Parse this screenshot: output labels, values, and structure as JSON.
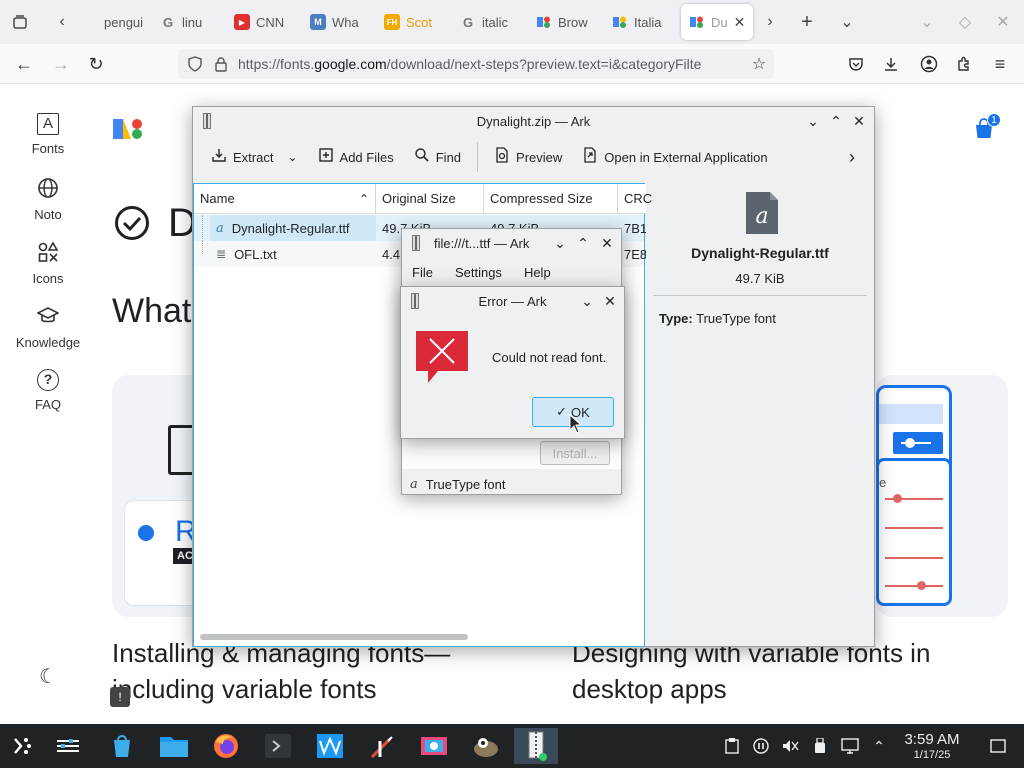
{
  "browser": {
    "tabs": [
      {
        "label": "pengui",
        "fav_color": "#5c5c5c",
        "fav": ""
      },
      {
        "label": "linu",
        "fav_color": "#4285f4",
        "fav": "G"
      },
      {
        "label": "CNN",
        "fav_color": "#cc0000",
        "fav": "▶"
      },
      {
        "label": "Wha",
        "fav_color": "#4a7fc1",
        "fav": "M"
      },
      {
        "label": "Scot",
        "fav_color": "#e8a000",
        "fav": "FH"
      },
      {
        "label": "italic",
        "fav_color": "#4285f4",
        "fav": "G"
      },
      {
        "label": "Brow",
        "fav_color": "#34a853",
        "fav": ""
      },
      {
        "label": "Italia",
        "fav_color": "#fbbc04",
        "fav": ""
      },
      {
        "label": "Du",
        "fav_color": "#4285f4",
        "fav": ""
      }
    ],
    "url_prefix": "https://fonts.",
    "url_domain": "google.com",
    "url_suffix": "/download/next-steps?preview.text=i&categoryFilte"
  },
  "gfonts": {
    "rail": [
      {
        "label": "Fonts",
        "icon": "A"
      },
      {
        "label": "Noto",
        "icon": "◎"
      },
      {
        "label": "Icons",
        "icon": "◈"
      },
      {
        "label": "Knowledge",
        "icon": "◬"
      },
      {
        "label": "FAQ",
        "icon": "?"
      }
    ],
    "cart_count": "1",
    "heading_letter": "D",
    "subheading": "What",
    "card_left_letter": "R",
    "card_badge": "ACTI",
    "card_right_letter": "e",
    "footer_left_line1": "Installing & managing fonts—",
    "footer_left_line2": "including variable fonts",
    "footer_right_line1": "Designing with variable fonts in",
    "footer_right_line2": "desktop apps"
  },
  "ark": {
    "title": "Dynalight.zip — Ark",
    "toolbar": {
      "extract": "Extract",
      "add_files": "Add Files",
      "find": "Find",
      "preview": "Preview",
      "open_external": "Open in External Application"
    },
    "columns": [
      "Name",
      "Original Size",
      "Compressed Size",
      "CRC"
    ],
    "files": [
      {
        "name": "Dynalight-Regular.ttf",
        "original": "49.7 KiB",
        "compressed": "49.7 KiB",
        "crc": "7B1"
      },
      {
        "name": "OFL.txt",
        "original": "4.4",
        "compressed": "",
        "crc": "7E8"
      }
    ],
    "info": {
      "filename": "Dynalight-Regular.ttf",
      "size": "49.7 KiB",
      "type_label": "Type:",
      "type_value": "TrueType font"
    }
  },
  "viewer": {
    "title": "file:///t...ttf — Ark",
    "menu": [
      "File",
      "Settings",
      "Help"
    ],
    "install_label": "Install...",
    "footer_type": "TrueType font"
  },
  "error": {
    "title": "Error — Ark",
    "message": "Could not read font.",
    "ok_label": "OK"
  },
  "taskbar": {
    "time": "3:59 AM",
    "date": "1/17/25"
  }
}
